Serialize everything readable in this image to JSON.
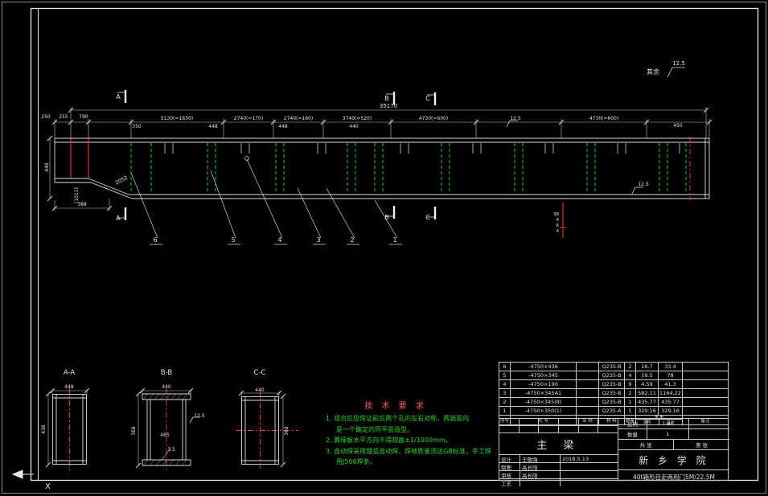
{
  "rough_top": {
    "prefix": "其余",
    "value": "12.5"
  },
  "dims": {
    "overall": "35170",
    "segments": [
      "5130(=1630)",
      "2740(=170)",
      "2740(=160)",
      "3740(=520)",
      "4730(=600)",
      "4730(=600)"
    ],
    "small_left": [
      "250",
      "255",
      "790"
    ],
    "small_mid": [
      "350",
      "448",
      "448",
      "440"
    ],
    "right_small": "450",
    "rough_mid": "12.5",
    "rough_bottom": "12.5",
    "taper": "2052",
    "paren": "(1011)",
    "height_left": "448",
    "bottom_left": "388",
    "weld_stack": [
      "38",
      "4",
      "6",
      "4"
    ]
  },
  "markers": {
    "a": "A",
    "b": "B",
    "c": "C"
  },
  "balloons": [
    "6",
    "5",
    "4",
    "3",
    "2",
    "1"
  ],
  "sections": {
    "a": {
      "label": "A-A",
      "top": "448",
      "side": "438"
    },
    "b": {
      "label": "B-B",
      "top": "440",
      "side": "368",
      "inner": "465",
      "gap": "3.5",
      "rough": "12.5"
    },
    "c": {
      "label": "C-C",
      "top": "440",
      "side": "368"
    }
  },
  "tech": {
    "title": "技 术 要 求",
    "lines": [
      "1. 组合后应保证前后两个孔的左右对称，两端面内",
      "是一个确定的同平面造型。",
      "2. 翼缘板水平方向不得翘曲±1/1000mm。",
      "3. 自动焊采用埋弧自动焊，焊缝质量须达GB标准，手工焊",
      "用J506焊条。"
    ]
  },
  "parts": {
    "headers": {
      "no": "序号",
      "code": "代  号",
      "name": "名  称",
      "mat": "材 料",
      "qty": "数量",
      "weight": "重 量",
      "unit": "单件",
      "total": "总计",
      "rem": "备注"
    },
    "rows": [
      {
        "no": "6",
        "code": "-4750×436",
        "name": "",
        "mat": "Q235-B",
        "qty": "2",
        "unit": "16.7",
        "total": "33.4",
        "rem": ""
      },
      {
        "no": "5",
        "code": "-4750×345",
        "name": "",
        "mat": "Q235-B",
        "qty": "4",
        "unit": "19.5",
        "total": "78",
        "rem": ""
      },
      {
        "no": "4",
        "code": "-4750×190",
        "name": "",
        "mat": "Q235-B",
        "qty": "9",
        "unit": "4.59",
        "total": "41.3",
        "rem": ""
      },
      {
        "no": "3",
        "code": "-4750×345A1",
        "name": "",
        "mat": "Q235-B",
        "qty": "2",
        "unit": "582.11",
        "total": "1164.22",
        "rem": ""
      },
      {
        "no": "2",
        "code": "-4750×345(8)",
        "name": "",
        "mat": "Q235-B",
        "qty": "1",
        "unit": "435.77",
        "total": "435.77",
        "rem": ""
      },
      {
        "no": "1",
        "code": "-4750×350(1)",
        "name": "",
        "mat": "Q235-A",
        "qty": "1",
        "unit": "329.16",
        "total": "329.16",
        "rem": ""
      }
    ]
  },
  "tb": {
    "name": "主  梁",
    "scale_label": "比例",
    "scale": "1:40",
    "qty_label": "数量",
    "qty": "1",
    "sheets": "共  张",
    "sheet": "第  张",
    "company": "新 乡 学 院",
    "project": "40t箱形自走两用门5M/22.5M",
    "sig": [
      {
        "role": "设计",
        "name": "王敬强",
        "date": "2018.5.13"
      },
      {
        "role": "制图",
        "name": "高长阳",
        "date": ""
      },
      {
        "role": "审核",
        "name": "高长阳",
        "date": ""
      },
      {
        "role": "工艺",
        "name": "",
        "date": ""
      }
    ]
  },
  "ucs": {
    "x_label": "X"
  }
}
